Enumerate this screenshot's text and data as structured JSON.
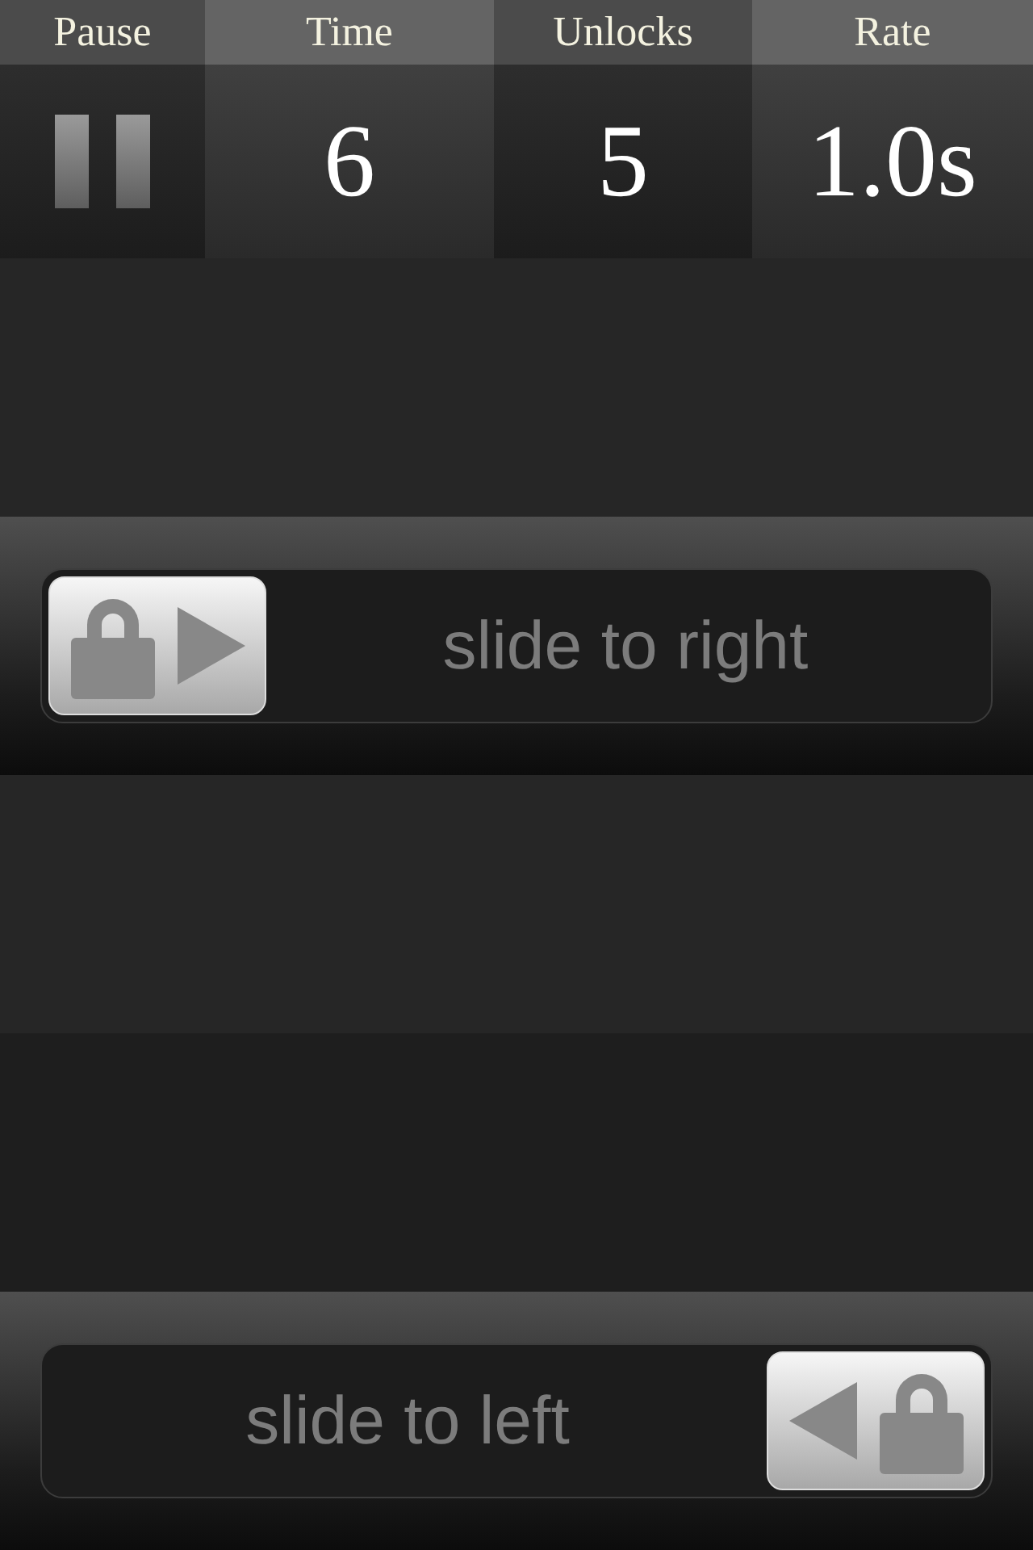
{
  "stats": [
    {
      "label": "Pause",
      "kind": "pause"
    },
    {
      "label": "Time",
      "kind": "value",
      "value": "6"
    },
    {
      "label": "Unlocks",
      "kind": "value",
      "value": "5"
    },
    {
      "label": "Rate",
      "kind": "value",
      "value": "1.0s"
    }
  ],
  "rows": [
    {
      "kind": "empty"
    },
    {
      "kind": "slider-right",
      "label": "slide to right"
    },
    {
      "kind": "empty"
    },
    {
      "kind": "empty"
    },
    {
      "kind": "slider-left",
      "label": "slide to left"
    }
  ]
}
